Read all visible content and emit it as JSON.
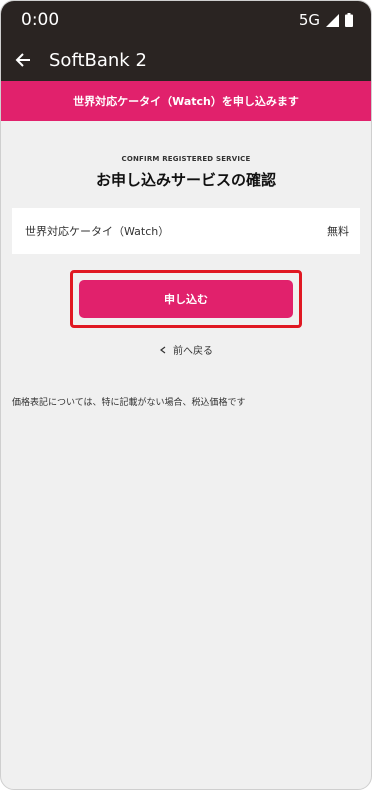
{
  "status_bar": {
    "time": "0:00",
    "network": "5G",
    "icons": [
      "signal-icon",
      "battery-icon"
    ]
  },
  "app_bar": {
    "title": "SoftBank 2",
    "back_icon": "arrow-left-icon"
  },
  "banner": {
    "text": "世界対応ケータイ（Watch）を申し込みます",
    "color": "#e1216c"
  },
  "confirm": {
    "overline": "CONFIRM REGISTERED SERVICE",
    "heading": "お申し込みサービスの確認"
  },
  "service": {
    "name": "世界対応ケータイ（Watch）",
    "price": "無料"
  },
  "actions": {
    "apply_label": "申し込む",
    "back_label": "前へ戻る",
    "back_icon": "chevron-left-icon"
  },
  "note": "価格表記については、特に記載がない場合、税込価格です",
  "colors": {
    "accent": "#e1216c",
    "highlight_border": "#e01822",
    "app_bar": "#2a2422"
  }
}
